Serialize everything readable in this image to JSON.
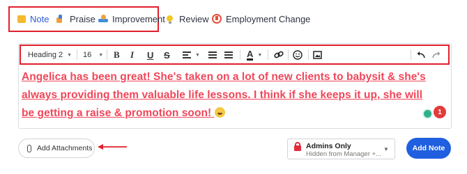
{
  "tabs": [
    {
      "label": "Note",
      "icon": "note-icon",
      "active": true
    },
    {
      "label": "Praise",
      "icon": "thumbs-up-icon"
    },
    {
      "label": "Improvement",
      "icon": "improvement-icon"
    },
    {
      "label": "Review",
      "icon": "lightbulb-icon"
    },
    {
      "label": "Employment Change",
      "icon": "employment-change-icon"
    }
  ],
  "toolbar": {
    "heading": "Heading 2",
    "font_size": "16",
    "bold": "B",
    "italic": "I",
    "underline": "U",
    "strikethrough": "S",
    "font_color": "A"
  },
  "editor": {
    "content": "Angelica has been great! She's taken on a lot of new clients to babysit & she's always providing them valuable life lessons. I think if she keeps it up, she will be getting a raise & promotion soon!",
    "badge_count": "1"
  },
  "footer": {
    "attach_label": "Add Attachments",
    "privacy_title": "Admins Only",
    "privacy_subtitle": "Hidden from Manager +...",
    "submit_label": "Add Note"
  },
  "colors": {
    "accent": "#1f5fe0",
    "highlight": "#e0202a",
    "content_text": "#f0475a"
  }
}
